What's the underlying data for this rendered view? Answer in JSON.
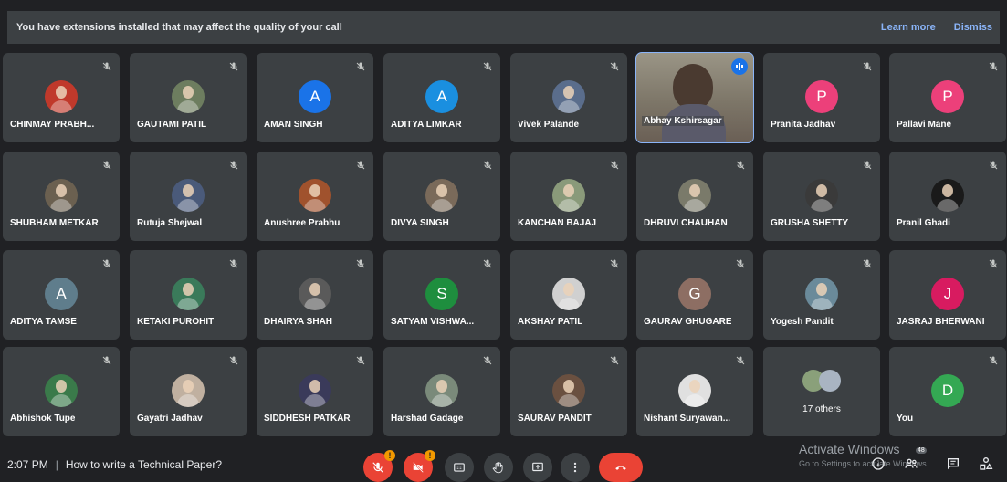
{
  "banner": {
    "message": "You have extensions installed that may affect the quality of your call",
    "learn_more": "Learn more",
    "dismiss": "Dismiss"
  },
  "participants": [
    {
      "name": "CHINMAY PRABH...",
      "avatar": "photo",
      "color": "#c0392b"
    },
    {
      "name": "GAUTAMI PATIL",
      "avatar": "photo",
      "color": "#6d7d5f"
    },
    {
      "name": "AMAN SINGH",
      "avatar": "A",
      "color": "#1a73e8"
    },
    {
      "name": "ADITYA LIMKAR",
      "avatar": "A",
      "color": "#1a8fe0"
    },
    {
      "name": "Vivek Palande",
      "avatar": "photo",
      "color": "#5a6d8c"
    },
    {
      "name": "Abhay Kshirsagar",
      "avatar": "video",
      "color": "#8d7d6a"
    },
    {
      "name": "Pranita Jadhav",
      "avatar": "P",
      "color": "#ec407a"
    },
    {
      "name": "Pallavi Mane",
      "avatar": "P",
      "color": "#ec407a"
    },
    {
      "name": "SHUBHAM METKAR",
      "avatar": "photo",
      "color": "#6b6050"
    },
    {
      "name": "Rutuja Shejwal",
      "avatar": "photo",
      "color": "#4a5a7a"
    },
    {
      "name": "Anushree Prabhu",
      "avatar": "photo",
      "color": "#a0522d"
    },
    {
      "name": "DIVYA SINGH",
      "avatar": "photo",
      "color": "#7a6a5a"
    },
    {
      "name": "KANCHAN BAJAJ",
      "avatar": "photo",
      "color": "#8a9a7a"
    },
    {
      "name": "DHRUVI CHAUHAN",
      "avatar": "photo",
      "color": "#7a7a6a"
    },
    {
      "name": "GRUSHA SHETTY",
      "avatar": "photo",
      "color": "#3a3a3a"
    },
    {
      "name": "Pranil Ghadi",
      "avatar": "photo",
      "color": "#1a1a1a"
    },
    {
      "name": "ADITYA TAMSE",
      "avatar": "A",
      "color": "#5f7d8c"
    },
    {
      "name": "KETAKI PUROHIT",
      "avatar": "photo",
      "color": "#3a7a5a"
    },
    {
      "name": "DHAIRYA SHAH",
      "avatar": "photo",
      "color": "#5a5a5a"
    },
    {
      "name": "SATYAM VISHWA...",
      "avatar": "S",
      "color": "#1e8e3e"
    },
    {
      "name": "AKSHAY PATIL",
      "avatar": "photo",
      "color": "#d0d0d0"
    },
    {
      "name": "GAURAV GHUGARE",
      "avatar": "G",
      "color": "#8d6e63"
    },
    {
      "name": "Yogesh Pandit",
      "avatar": "photo",
      "color": "#6a8a9a"
    },
    {
      "name": "JASRAJ BHERWANI",
      "avatar": "J",
      "color": "#d81b60"
    },
    {
      "name": "Abhishok Tupe",
      "avatar": "photo",
      "color": "#3a7a4a"
    },
    {
      "name": "Gayatri Jadhav",
      "avatar": "photo",
      "color": "#c0b0a0"
    },
    {
      "name": "SIDDHESH PATKAR",
      "avatar": "photo",
      "color": "#3a3a5a"
    },
    {
      "name": "Harshad Gadage",
      "avatar": "photo",
      "color": "#7a8a7a"
    },
    {
      "name": "SAURAV PANDIT",
      "avatar": "photo",
      "color": "#6a5040"
    },
    {
      "name": "Nishant Suryawan...",
      "avatar": "photo",
      "color": "#e0e0e0"
    },
    {
      "name": "17 others",
      "avatar": "others",
      "color": "#5f6368"
    },
    {
      "name": "You",
      "avatar": "D",
      "color": "#34a853"
    }
  ],
  "meeting": {
    "time": "2:07 PM",
    "title": "How to write a Technical Paper?"
  },
  "controls": {
    "mic_warning": "!",
    "cam_warning": "!",
    "people_count": "48"
  },
  "watermark": {
    "line1": "Activate Windows",
    "line2": "Go to Settings to activate Windows."
  },
  "icons": {
    "mute": "mic-off-icon",
    "captions": "closed-captions-icon",
    "hand": "raise-hand-icon",
    "present": "present-screen-icon",
    "more": "more-vert-icon",
    "end": "end-call-icon",
    "info": "info-icon",
    "people": "people-icon",
    "chat": "chat-icon",
    "activities": "activities-icon"
  }
}
